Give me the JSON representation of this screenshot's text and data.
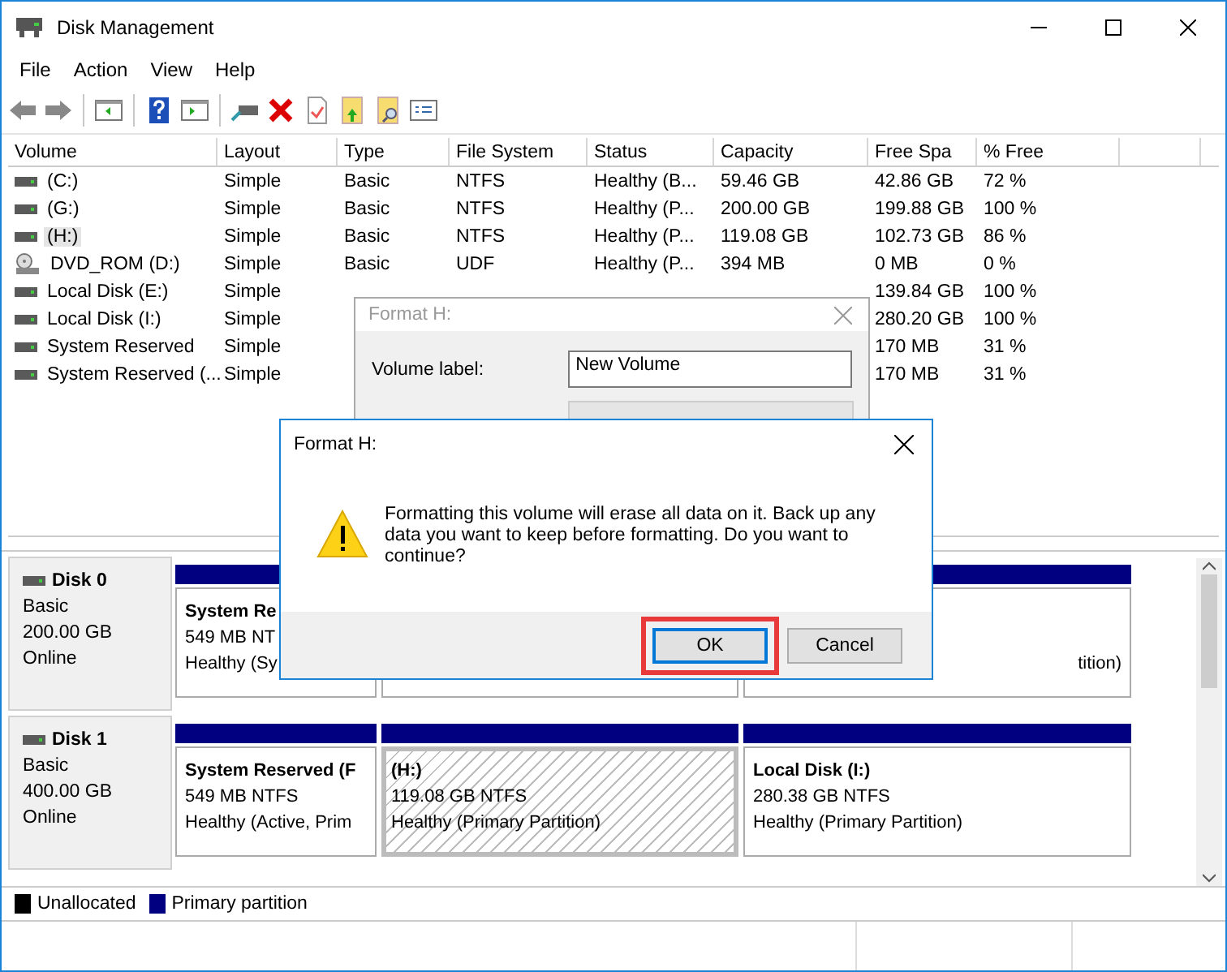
{
  "window": {
    "title": "Disk Management"
  },
  "menu": [
    "File",
    "Action",
    "View",
    "Help"
  ],
  "table": {
    "columns": [
      "Volume",
      "Layout",
      "Type",
      "File System",
      "Status",
      "Capacity",
      "Free Spa",
      "% Free"
    ],
    "rows": [
      {
        "kind": "disk",
        "selected": false,
        "cells": [
          "(C:)",
          "Simple",
          "Basic",
          "NTFS",
          "Healthy (B...",
          "59.46 GB",
          "42.86 GB",
          "72 %"
        ]
      },
      {
        "kind": "disk",
        "selected": false,
        "cells": [
          "(G:)",
          "Simple",
          "Basic",
          "NTFS",
          "Healthy (P...",
          "200.00 GB",
          "199.88 GB",
          "100 %"
        ]
      },
      {
        "kind": "disk",
        "selected": true,
        "cells": [
          "(H:)",
          "Simple",
          "Basic",
          "NTFS",
          "Healthy (P...",
          "119.08 GB",
          "102.73 GB",
          "86 %"
        ]
      },
      {
        "kind": "dvd",
        "selected": false,
        "cells": [
          "DVD_ROM (D:)",
          "Simple",
          "Basic",
          "UDF",
          "Healthy (P...",
          "394 MB",
          "0 MB",
          "0 %"
        ]
      },
      {
        "kind": "disk",
        "selected": false,
        "cells": [
          "Local Disk (E:)",
          "Simple",
          null,
          null,
          null,
          null,
          "139.84 GB",
          "100 %"
        ]
      },
      {
        "kind": "disk",
        "selected": false,
        "cells": [
          "Local Disk (I:)",
          "Simple",
          null,
          null,
          null,
          null,
          "280.20 GB",
          "100 %"
        ]
      },
      {
        "kind": "disk",
        "selected": false,
        "cells": [
          "System Reserved",
          "Simple",
          null,
          null,
          null,
          null,
          "170 MB",
          "31 %"
        ]
      },
      {
        "kind": "disk",
        "selected": false,
        "cells": [
          "System Reserved (...",
          "Simple",
          null,
          null,
          null,
          null,
          "170 MB",
          "31 %"
        ]
      }
    ]
  },
  "disks": [
    {
      "name": "Disk 0",
      "type": "Basic",
      "size": "200.00 GB",
      "status": "Online",
      "partitions": [
        {
          "name": "System Re",
          "detail": "549 MB NT",
          "health": "Healthy (Sy",
          "selected": false
        },
        {
          "selected": false
        },
        {
          "health": "tition)",
          "selected": false
        }
      ]
    },
    {
      "name": "Disk 1",
      "type": "Basic",
      "size": "400.00 GB",
      "status": "Online",
      "partitions": [
        {
          "name": "System Reserved  (F",
          "detail": "549 MB NTFS",
          "health": "Healthy (Active, Prim",
          "selected": false
        },
        {
          "name": "(H:)",
          "detail": "119.08 GB NTFS",
          "health": "Healthy (Primary Partition)",
          "selected": true
        },
        {
          "name": "Local Disk  (I:)",
          "detail": "280.38 GB NTFS",
          "health": "Healthy (Primary Partition)",
          "selected": false
        }
      ]
    }
  ],
  "legend": [
    {
      "label": "Unallocated",
      "color": "#000000"
    },
    {
      "label": "Primary partition",
      "color": "#000080"
    }
  ],
  "format_dialog": {
    "title": "Format H:",
    "volume_label": {
      "label": "Volume label:",
      "value": "New Volume"
    }
  },
  "confirm_dialog": {
    "title": "Format H:",
    "message": "Formatting this volume will erase all data on it. Back up any data you want to keep before formatting. Do you want to continue?",
    "buttons": [
      {
        "label": "OK",
        "focused": true
      },
      {
        "label": "Cancel",
        "focused": false
      }
    ]
  }
}
